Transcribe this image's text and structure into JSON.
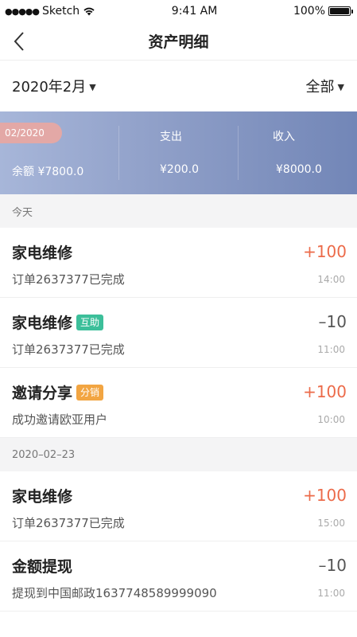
{
  "status_bar": {
    "carrier": "Sketch",
    "time": "9:41 AM",
    "battery": "100%"
  },
  "nav": {
    "title": "资产明细"
  },
  "filters": {
    "month": "2020年2月",
    "type": "全部"
  },
  "summary": {
    "month_badge": "02/2020",
    "balance": "余额 ¥7800.0",
    "expense_label": "支出",
    "expense_value": "¥200.0",
    "income_label": "收入",
    "income_value": "¥8000.0"
  },
  "colors": {
    "positive": "#ec6b4a",
    "negative": "#555555",
    "tag_green": "#3cbf9a",
    "tag_orange": "#f2a542"
  },
  "sections": [
    {
      "header": "今天",
      "items": [
        {
          "title": "家电维修",
          "tag": "",
          "sub": "订单2637377已完成",
          "amount": "+100",
          "time": "14:00"
        },
        {
          "title": "家电维修",
          "tag": "互助",
          "sub": "订单2637377已完成",
          "amount": "–10",
          "time": "11:00"
        },
        {
          "title": "邀请分享",
          "tag": "分销",
          "sub": "成功邀请欧亚用户",
          "amount": "+100",
          "time": "10:00"
        }
      ]
    },
    {
      "header": "2020–02–23",
      "items": [
        {
          "title": "家电维修",
          "tag": "",
          "sub": "订单2637377已完成",
          "amount": "+100",
          "time": "15:00"
        },
        {
          "title": "金额提现",
          "tag": "",
          "sub": "提现到中国邮政1637748589999090",
          "amount": "–10",
          "time": "11:00"
        }
      ]
    }
  ]
}
